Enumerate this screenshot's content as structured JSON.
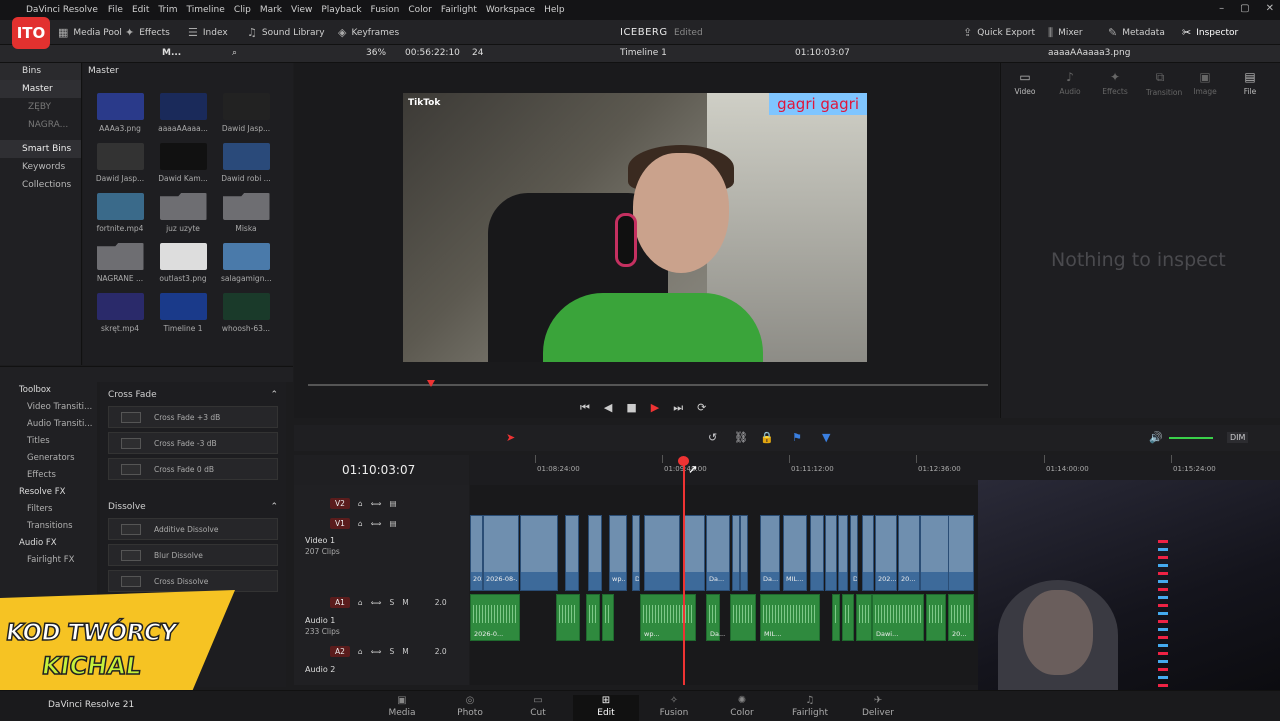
{
  "menubar": {
    "app_name": "DaVinci Resolve",
    "items": [
      "File",
      "Edit",
      "Trim",
      "Timeline",
      "Clip",
      "Mark",
      "View",
      "Playback",
      "Fusion",
      "Color",
      "Fairlight",
      "Workspace",
      "Help"
    ]
  },
  "toolbar": {
    "media_pool": "Media Pool",
    "effects": "Effects",
    "index": "Index",
    "sound_library": "Sound Library",
    "keyframes": "Keyframes",
    "project_title": "ICEBERG",
    "project_status": "Edited",
    "quick_export": "Quick Export",
    "mixer": "Mixer",
    "metadata": "Metadata",
    "inspector": "Inspector"
  },
  "subbar": {
    "m_label": "M...",
    "zoom": "36%",
    "source_tc": "00:56:22:10",
    "fps": "24",
    "timeline_name": "Timeline 1",
    "record_tc": "01:10:03:07",
    "inspector_file": "aaaaAAaaaa3.png"
  },
  "bins": {
    "header": "Bins",
    "master": "Master",
    "items": [
      "ZĘBY",
      "NAGRA..."
    ],
    "smart_bins": "Smart Bins",
    "smart_items": [
      "Keywords",
      "Collections"
    ]
  },
  "media_pool": {
    "header": "Master",
    "clips": [
      {
        "name": "AAAa3.png",
        "color": "#2a3a8a"
      },
      {
        "name": "aaaaAAaaa...",
        "color": "#1a2a5a"
      },
      {
        "name": "Dawid Jasp...",
        "color": "#222"
      },
      {
        "name": "Dawid Jasp...",
        "color": "#333"
      },
      {
        "name": "Dawid Kam...",
        "color": "#111"
      },
      {
        "name": "Dawid robi ...",
        "color": "#2a4a7a"
      },
      {
        "name": "fortnite.mp4",
        "color": "#3a6a8a"
      },
      {
        "name": "juz uzyte",
        "color": "folder"
      },
      {
        "name": "Miska",
        "color": "folder"
      },
      {
        "name": "NAGRANE ...",
        "color": "folder"
      },
      {
        "name": "outlast3.png",
        "color": "#ddd"
      },
      {
        "name": "salagamign...",
        "color": "#4a7aaa"
      },
      {
        "name": "skręt.mp4",
        "color": "#2a2a6a"
      },
      {
        "name": "Timeline 1",
        "color": "#1a3a8a"
      },
      {
        "name": "whoosh-63...",
        "color": "#1a3a2a"
      }
    ]
  },
  "viewer": {
    "overlay_text": "gagri gagri",
    "tiktok": "TikTok"
  },
  "inspector": {
    "tabs": [
      "Video",
      "Audio",
      "Effects",
      "Transition",
      "Image",
      "File"
    ],
    "empty": "Nothing to inspect"
  },
  "toolbox": {
    "header": "Toolbox",
    "items": [
      "Video Transiti...",
      "Audio Transiti...",
      "Titles",
      "Generators",
      "Effects"
    ],
    "resolve_fx": "Resolve FX",
    "resolve_items": [
      "Filters",
      "Transitions"
    ],
    "audio_fx": "Audio FX",
    "audio_items": [
      "Fairlight FX"
    ]
  },
  "fx": {
    "cross_fade": "Cross Fade",
    "cross_items": [
      "Cross Fade +3 dB",
      "Cross Fade -3 dB",
      "Cross Fade 0 dB"
    ],
    "dissolve": "Dissolve",
    "dissolve_items": [
      "Additive Dissolve",
      "Blur Dissolve",
      "Cross Dissolve"
    ]
  },
  "timeline": {
    "timecode": "01:10:03:07",
    "ruler": [
      "01:08:24:00",
      "01:09:48:00",
      "01:11:12:00",
      "01:12:36:00",
      "01:14:00:00",
      "01:15:24:00"
    ],
    "tracks": {
      "v2": "V2",
      "v1": "V1",
      "video1_name": "Video 1",
      "video1_info": "207 Clips",
      "a1": "A1",
      "audio1_name": "Audio 1",
      "audio1_info": "233 Clips",
      "a1_level": "2.0",
      "a2": "A2",
      "audio2_name": "Audio 2",
      "a2_level": "2.0"
    },
    "video_clip_labels": [
      "2026-0...",
      "2026-08-...",
      "wp...",
      "Da...",
      "Da...",
      "Da...",
      "MIL...",
      "Dawi...",
      "202...",
      "20..."
    ],
    "audio_clip_labels": [
      "2026-0...",
      "wp...",
      "Da...",
      "MIL...",
      "Dawi...",
      "20..."
    ],
    "dim": "DIM"
  },
  "pages": {
    "brand": "DaVinci Resolve 21",
    "tabs": [
      "Media",
      "Photo",
      "Cut",
      "Edit",
      "Fusion",
      "Color",
      "Fairlight",
      "Deliver"
    ]
  },
  "overlay": {
    "logo": "ITO",
    "banner_line1": "KOD TWÓRCY",
    "banner_line2": "KICHAL"
  }
}
